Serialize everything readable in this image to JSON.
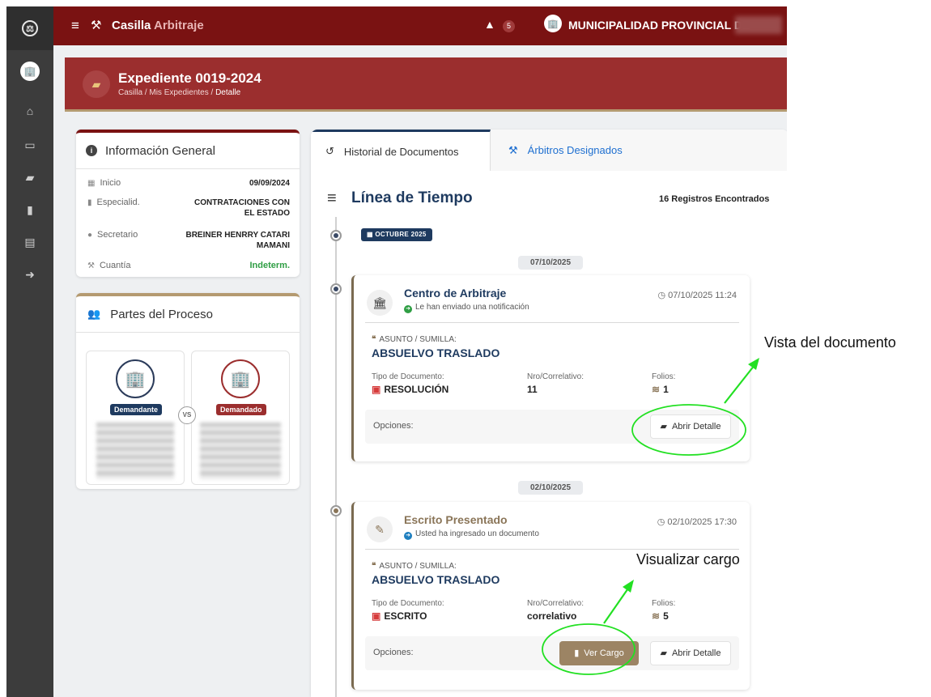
{
  "topbar": {
    "brand_a": "Casilla",
    "brand_b": "Arbitraje",
    "notif_count": "5",
    "org": "MUNICIPALIDAD PROVINCIAL DE"
  },
  "header": {
    "title": "Expediente 0019-2024",
    "crumb_1": "Casilla",
    "crumb_2": "Mis Expedientes",
    "crumb_3": "Detalle",
    "sep": "/"
  },
  "info": {
    "title": "Información General",
    "rows": [
      {
        "label": "Inicio",
        "value": "09/09/2024"
      },
      {
        "label": "Especialid.",
        "value": "CONTRATACIONES CON EL ESTADO"
      },
      {
        "label": "Secretario",
        "value": "BREINER HENRRY CATARI MAMANI"
      },
      {
        "label": "Cuantía",
        "value": "Indeterm."
      }
    ]
  },
  "parties": {
    "title": "Partes del Proceso",
    "plaintiff": "Demandante",
    "defendant": "Demandado",
    "vs": "VS"
  },
  "tabs": [
    {
      "label": "Historial de Documentos"
    },
    {
      "label": "Árbitros Designados"
    }
  ],
  "timeline": {
    "title": "Línea de Tiempo",
    "count": "16 Registros Encontrados",
    "month": "OCTUBRE 2025",
    "entries": [
      {
        "date": "07/10/2025",
        "title": "Centro de Arbitraje",
        "subtitle": "Le han enviado una notificación",
        "time": "07/10/2025 11:24",
        "subject_label": "ASUNTO / SUMILLA:",
        "subject": "ABSUELVO TRASLADO",
        "doc_type_label": "Tipo de Documento:",
        "doc_type": "RESOLUCIÓN",
        "number_label": "Nro/Correlativo:",
        "number": "11",
        "folios_label": "Folios:",
        "folios": "1",
        "options_label": "Opciones:",
        "detail_button": "Abrir Detalle"
      },
      {
        "date": "02/10/2025",
        "title": "Escrito Presentado",
        "subtitle": "Usted ha ingresado un documento",
        "time": "02/10/2025 17:30",
        "subject_label": "ASUNTO / SUMILLA:",
        "subject": "ABSUELVO TRASLADO",
        "doc_type_label": "Tipo de Documento:",
        "doc_type": "ESCRITO",
        "number_label": "Nro/Correlativo:",
        "number": "correlativo",
        "folios_label": "Folios:",
        "folios": "5",
        "options_label": "Opciones:",
        "cargo_button": "Ver Cargo",
        "detail_button": "Abrir Detalle"
      }
    ]
  },
  "annotations": {
    "vista": "Vista del documento",
    "cargo": "Visualizar cargo"
  },
  "colors": {
    "topbar": "#7a1212",
    "header_band": "#9b2e2e",
    "accent_navy": "#1e3a5f",
    "accent_tan": "#9c8464",
    "annotation_green": "#22e022"
  },
  "icons": [
    "scale-icon",
    "menu-icon",
    "gavel-icon",
    "inbox-icon",
    "building-icon",
    "home-icon",
    "folder-icon",
    "file-icon",
    "book-icon",
    "logout-icon",
    "info-icon",
    "users-icon",
    "history-icon",
    "list-icon",
    "calendar-icon",
    "bookmark-icon",
    "user-tie-icon",
    "clock-icon",
    "quote-icon",
    "pdf-icon",
    "layers-icon"
  ]
}
